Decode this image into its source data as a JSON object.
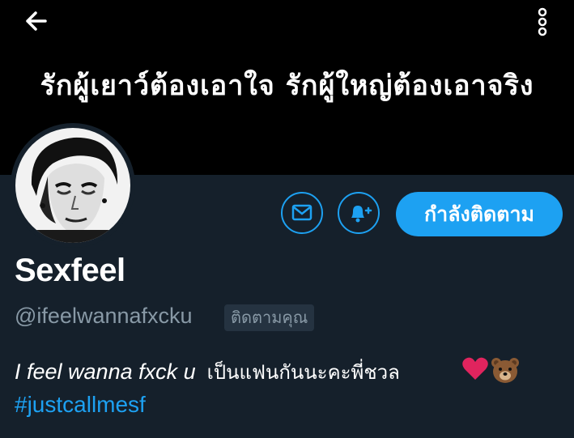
{
  "header": {
    "back_icon": "arrow-left-icon",
    "more_icon": "vertical-dots-icon",
    "banner_text": "รักผู้เยาว์ต้องเอาใจ รักผู้ใหญ่ต้องเอาจริง"
  },
  "profile": {
    "display_name": "Sexfeel",
    "handle": "@ifeelwannafxcku",
    "follows_you_badge": "ติดตามคุณ",
    "bio_english": "I feel wanna fxck u",
    "bio_thai": "เป็นแฟนกันนะคะพี่ชวล",
    "bio_emojis": [
      "red-heart-icon",
      "bear-face-icon"
    ],
    "hashtag": "#justcallmesf"
  },
  "actions": {
    "message_icon": "envelope-icon",
    "notify_icon": "bell-plus-icon",
    "following_label": "กำลังติดตาม"
  },
  "colors": {
    "background": "#15202b",
    "banner": "#000000",
    "accent": "#1da1f2",
    "secondary_text": "#8899a6",
    "badge_bg": "#253341",
    "heart": "#e0245e"
  }
}
